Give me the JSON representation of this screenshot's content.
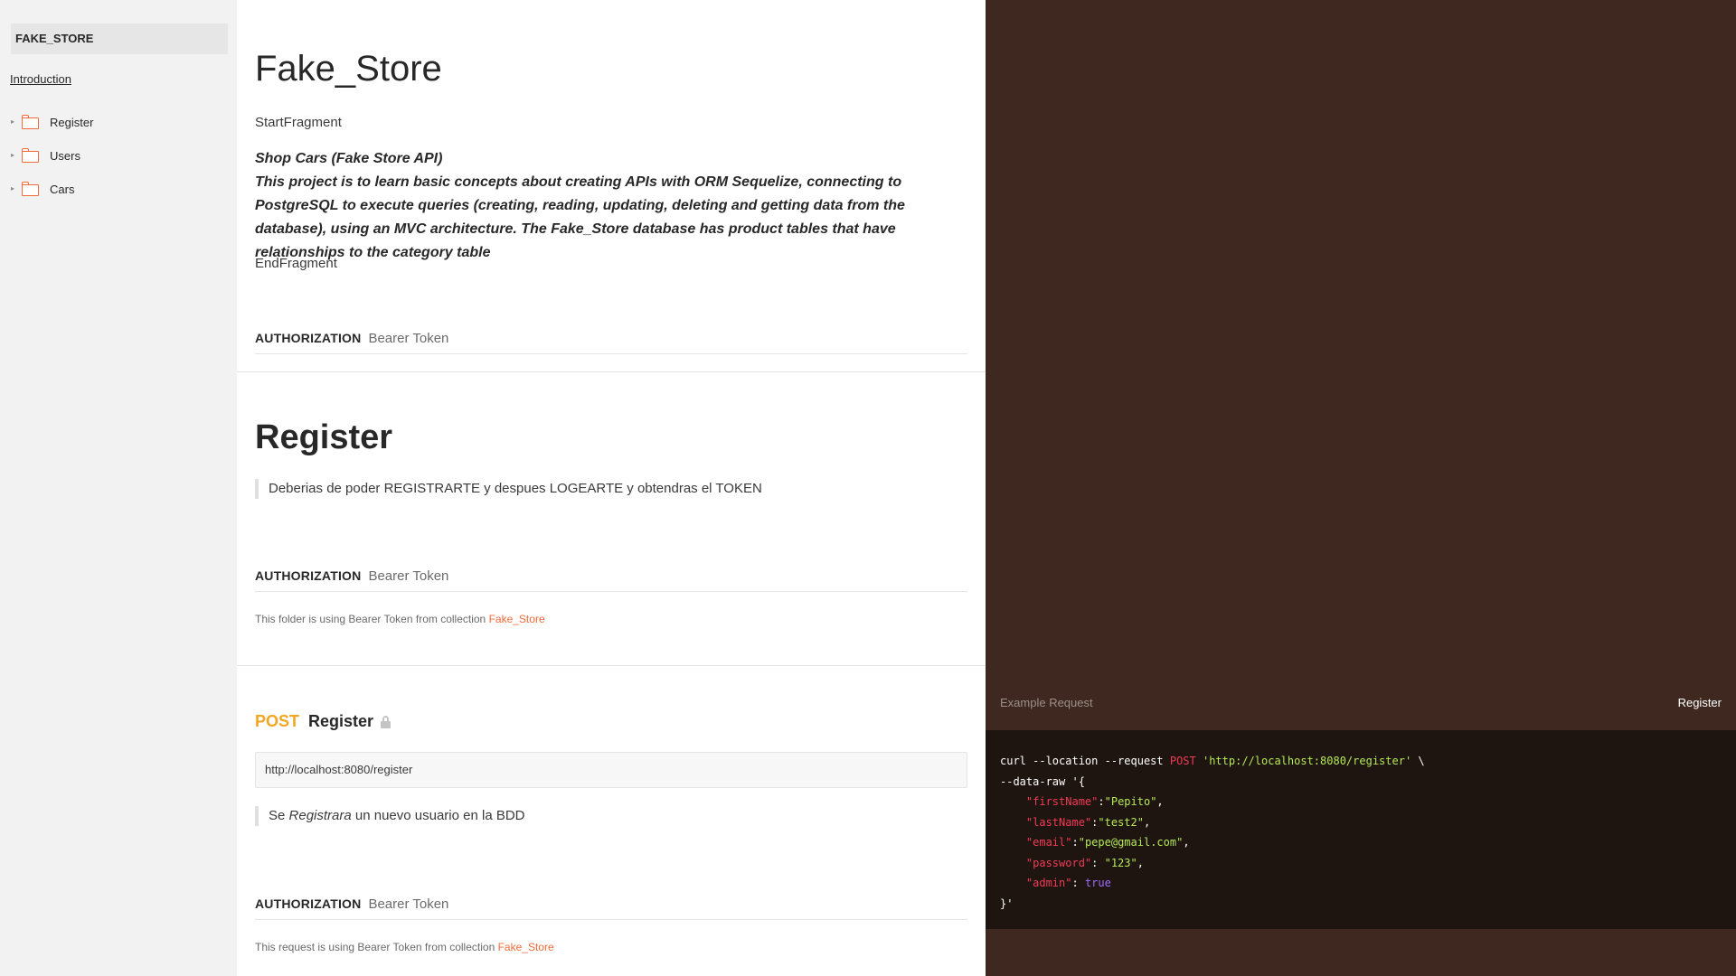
{
  "sidebar": {
    "title": "FAKE_STORE",
    "intro_link": "Introduction",
    "items": [
      {
        "label": "Register"
      },
      {
        "label": "Users"
      },
      {
        "label": "Cars"
      }
    ]
  },
  "intro": {
    "title": "Fake_Store",
    "start_fragment": "StartFragment",
    "desc_title": "Shop Cars (Fake Store API)",
    "desc_body": "This project is to learn basic concepts about creating APIs with ORM Sequelize, connecting to PostgreSQL to execute queries (creating, reading, updating, deleting and getting data from the database), using an MVC architecture. The Fake_Store database has product tables that have relationships to the category table",
    "end_fragment": "EndFragment",
    "auth_key": "AUTHORIZATION",
    "auth_value": "Bearer Token"
  },
  "folder": {
    "title": "Register",
    "quote": "Deberias de poder REGISTRARTE y despues LOGEARTE y obtendras el TOKEN",
    "auth_key": "AUTHORIZATION",
    "auth_value": "Bearer Token",
    "note_prefix": "This folder is using Bearer Token from collection",
    "note_link": "Fake_Store"
  },
  "request": {
    "method": "POST",
    "name": "Register",
    "url": "http://localhost:8080/register",
    "quote_pre": "Se ",
    "quote_em": "Registrara",
    "quote_post": " un nuevo usuario en la BDD",
    "auth_key": "AUTHORIZATION",
    "auth_value": "Bearer Token",
    "note_prefix": "This request is using Bearer Token from collection",
    "note_link": "Fake_Store"
  },
  "example": {
    "label": "Example Request",
    "selected": "Register",
    "code": {
      "curl": "curl --location --request ",
      "method": "POST",
      "url": "'http://localhost:8080/register'",
      "cont": " \\",
      "data_raw": "--data-raw '{",
      "fields": [
        {
          "key": "\"firstName\"",
          "sep": ":",
          "val": "\"Pepito\"",
          "end": ","
        },
        {
          "key": "\"lastName\"",
          "sep": ":",
          "val": "\"test2\"",
          "end": ","
        },
        {
          "key": "\"email\"",
          "sep": ":",
          "val": "\"pepe@gmail.com\"",
          "end": ","
        },
        {
          "key": "\"password\"",
          "sep": ": ",
          "val": "\"123\"",
          "end": ","
        },
        {
          "key": "\"admin\"",
          "sep": ": ",
          "val": "true",
          "end": ""
        }
      ],
      "closing": "}'"
    }
  },
  "colors": {
    "accent": "#f26b3a",
    "post": "#f4a623",
    "panel": "#3e2820",
    "code_bg": "#1e1511"
  }
}
